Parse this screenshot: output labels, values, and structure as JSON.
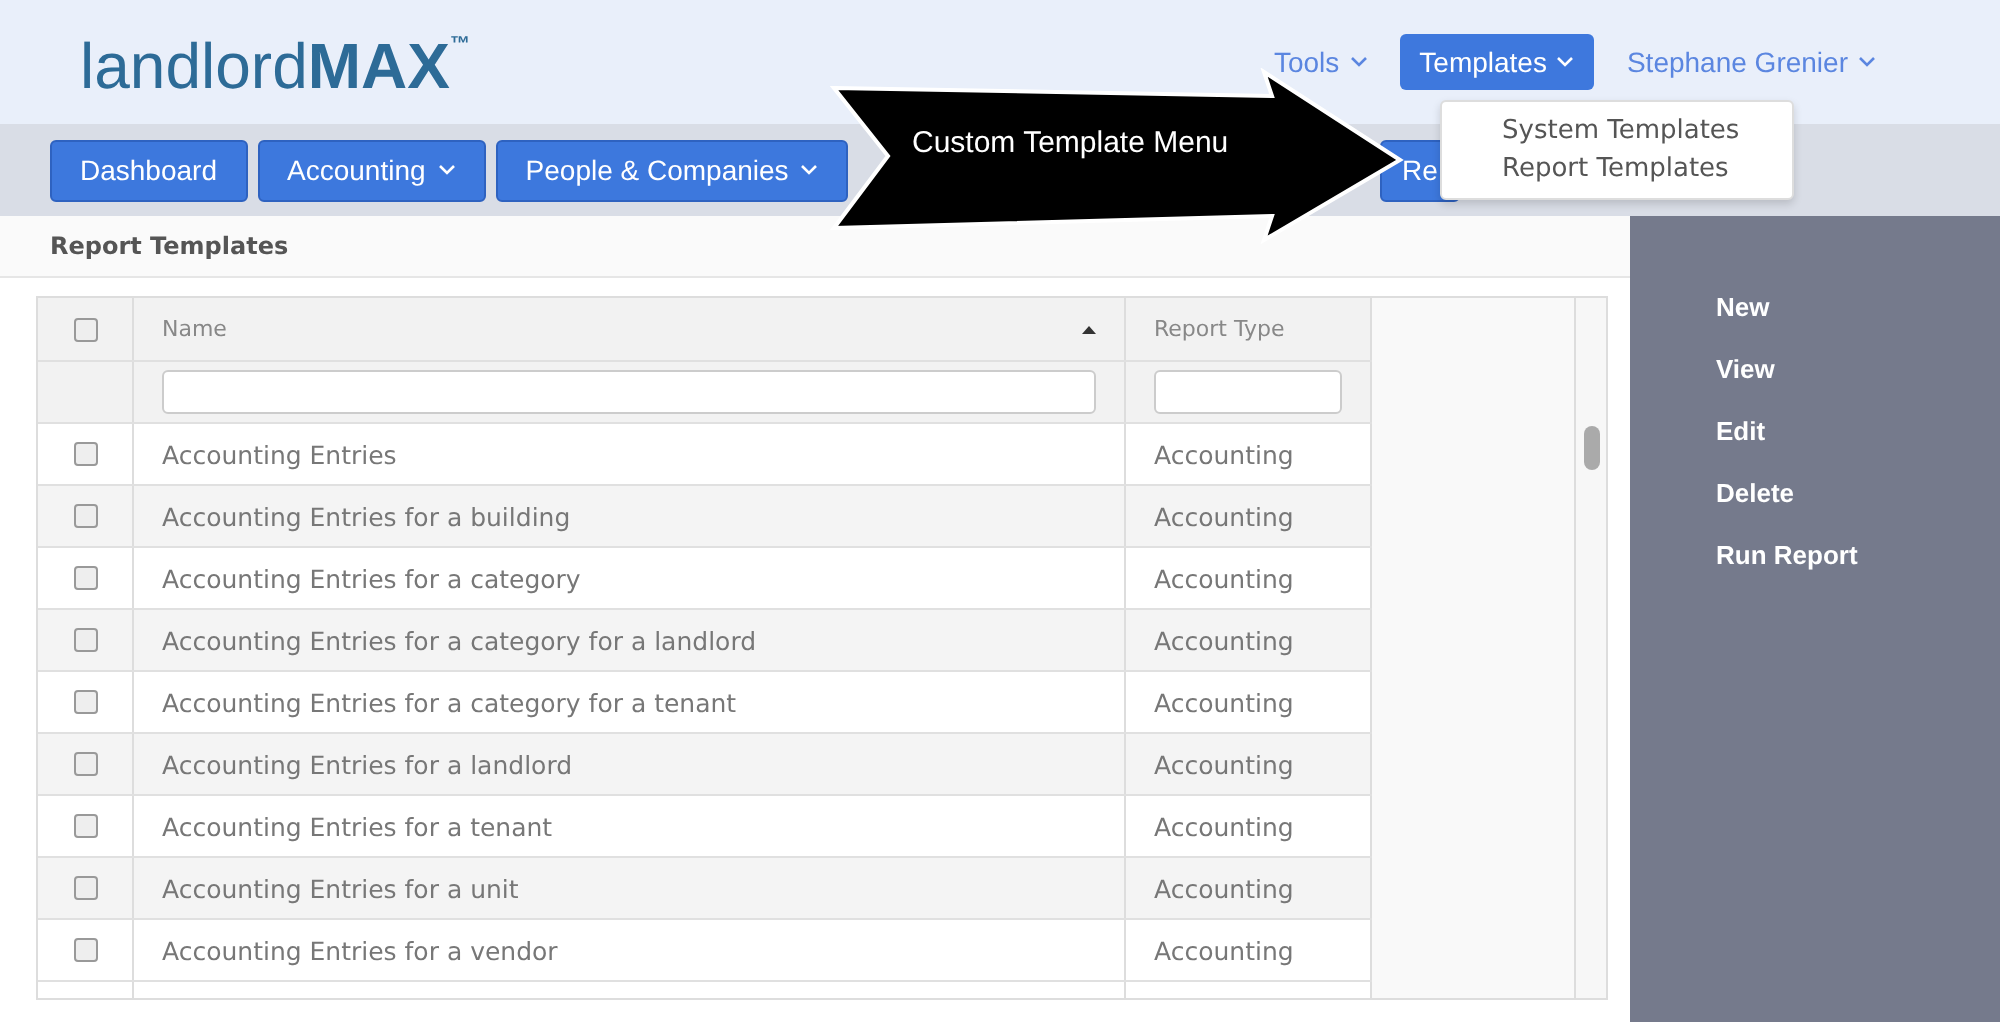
{
  "logo": {
    "light": "landlord",
    "bold": "MAX",
    "mark": "™"
  },
  "top_menu": [
    {
      "label": "Tools",
      "selected": false
    },
    {
      "label": "Templates",
      "selected": true
    },
    {
      "label": "Stephane Grenier",
      "selected": false
    }
  ],
  "dropdown": [
    "System Templates",
    "Report Templates"
  ],
  "nav": [
    {
      "label": "Dashboard",
      "caret": false
    },
    {
      "label": "Accounting",
      "caret": true
    },
    {
      "label": "People & Companies",
      "caret": true
    },
    {
      "label": "Re",
      "caret": false
    }
  ],
  "callout": "Custom Template Menu",
  "page_title": "Report Templates",
  "table": {
    "all_checked": false,
    "columns": [
      {
        "label": "Name",
        "sorted": true
      },
      {
        "label": "Report Type",
        "sorted": false
      }
    ],
    "rows": [
      {
        "name": "Accounting Entries",
        "type": "Accounting",
        "checked": false
      },
      {
        "name": "Accounting Entries for a building",
        "type": "Accounting",
        "checked": false
      },
      {
        "name": "Accounting Entries for a category",
        "type": "Accounting",
        "checked": false
      },
      {
        "name": "Accounting Entries for a category for a landlord",
        "type": "Accounting",
        "checked": false
      },
      {
        "name": "Accounting Entries for a category for a tenant",
        "type": "Accounting",
        "checked": false
      },
      {
        "name": "Accounting Entries for a landlord",
        "type": "Accounting",
        "checked": false
      },
      {
        "name": "Accounting Entries for a tenant",
        "type": "Accounting",
        "checked": false
      },
      {
        "name": "Accounting Entries for a unit",
        "type": "Accounting",
        "checked": false
      },
      {
        "name": "Accounting Entries for a vendor",
        "type": "Accounting",
        "checked": false
      }
    ]
  },
  "actions": [
    "New",
    "View",
    "Edit",
    "Delete",
    "Run Report"
  ]
}
